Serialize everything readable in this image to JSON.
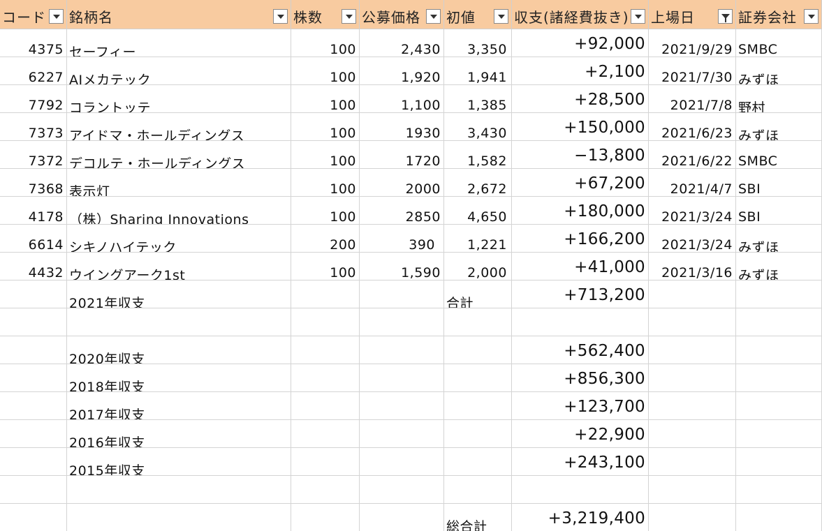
{
  "headers": [
    {
      "label": "コード",
      "filter": "dropdown"
    },
    {
      "label": "銘柄名",
      "filter": "dropdown"
    },
    {
      "label": "株数",
      "filter": "dropdown"
    },
    {
      "label": "公募価格",
      "filter": "dropdown"
    },
    {
      "label": "初値",
      "filter": "dropdown"
    },
    {
      "label": "収支(諸経費抜き)",
      "filter": "dropdown"
    },
    {
      "label": "上場日",
      "filter": "active"
    },
    {
      "label": "証券会社",
      "filter": "dropdown"
    }
  ],
  "rows": [
    {
      "code": "4375",
      "name": "セーフィー",
      "shares": "100",
      "offer": "2,430",
      "initial": "3,350",
      "pnl": "+92,000",
      "date": "2021/9/29",
      "broker": "SMBC"
    },
    {
      "code": "6227",
      "name": "AIメカテック",
      "shares": "100",
      "offer": "1,920",
      "initial": "1,941",
      "pnl": "+2,100",
      "date": "2021/7/30",
      "broker": "みずほ"
    },
    {
      "code": "7792",
      "name": "コラントッテ",
      "shares": "100",
      "offer": "1,100",
      "initial": "1,385",
      "pnl": "+28,500",
      "date": "2021/7/8",
      "broker": "野村"
    },
    {
      "code": "7373",
      "name": "アイドマ・ホールディングス",
      "shares": "100",
      "offer": "1930",
      "initial": "3,430",
      "pnl": "+150,000",
      "date": "2021/6/23",
      "broker": "みずほ"
    },
    {
      "code": "7372",
      "name": "デコルテ・ホールディングス",
      "shares": "100",
      "offer": "1720",
      "initial": "1,582",
      "pnl": "−13,800",
      "date": "2021/6/22",
      "broker": "SMBC"
    },
    {
      "code": "7368",
      "name": "表示灯",
      "shares": "100",
      "offer": "2000",
      "initial": "2,672",
      "pnl": "+67,200",
      "date": "2021/4/7",
      "broker": "SBI"
    },
    {
      "code": "4178",
      "name": "（株）Sharing  Innovations",
      "shares": "100",
      "offer": "2850",
      "initial": "4,650",
      "pnl": "+180,000",
      "date": "2021/3/24",
      "broker": "SBI"
    },
    {
      "code": "6614",
      "name": "シキノハイテック",
      "shares": "200",
      "offer": "390",
      "initial": "1,221",
      "pnl": "+166,200",
      "date": "2021/3/24",
      "broker": "みずほ"
    },
    {
      "code": "4432",
      "name": "ウイングアーク1st",
      "shares": "100",
      "offer": "1,590",
      "initial": "2,000",
      "pnl": "+41,000",
      "date": "2021/3/16",
      "broker": "みずほ"
    }
  ],
  "summary_2021": {
    "label": "2021年収支",
    "total_label": "合計",
    "value": "+713,200"
  },
  "yearly": [
    {
      "label": "2020年収支",
      "value": "+562,400"
    },
    {
      "label": "2018年収支",
      "value": "+856,300"
    },
    {
      "label": "2017年収支",
      "value": "+123,700"
    },
    {
      "label": "2016年収支",
      "value": "+22,900"
    },
    {
      "label": "2015年収支",
      "value": "+243,100"
    }
  ],
  "grand_total": {
    "label": "総合計",
    "value": "+3,219,400"
  },
  "colors": {
    "header_bg": "#f8cba0",
    "grid": "#d4d4d4"
  }
}
